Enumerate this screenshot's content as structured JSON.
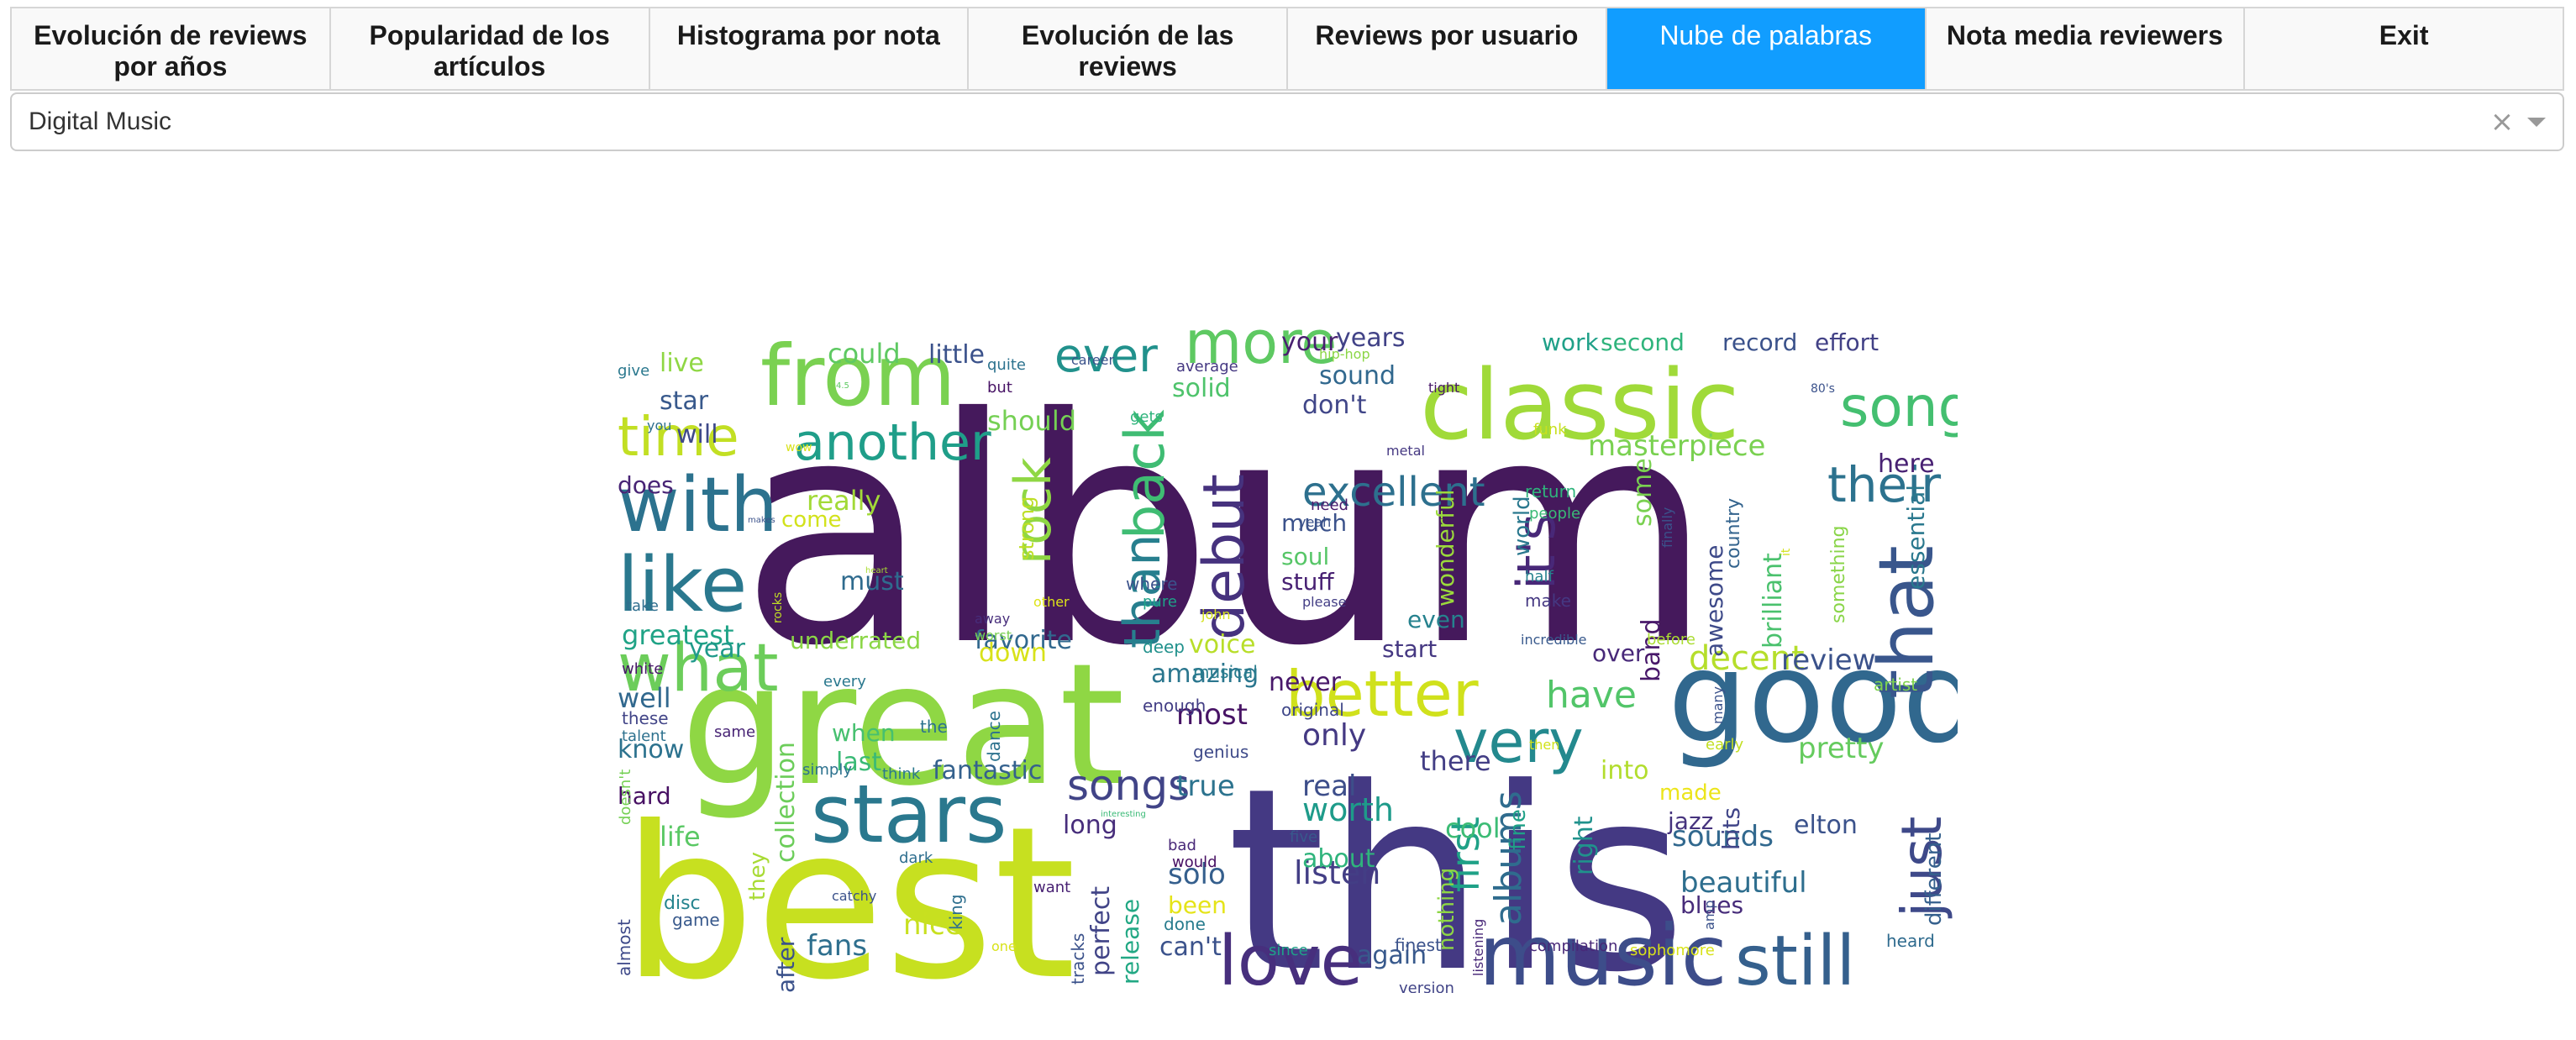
{
  "tabs": [
    {
      "label": "Evolución de reviews por años",
      "active": false
    },
    {
      "label": "Popularidad de los artículos",
      "active": false
    },
    {
      "label": "Histograma por nota",
      "active": false
    },
    {
      "label": "Evolución de las reviews",
      "active": false
    },
    {
      "label": "Reviews por usuario",
      "active": false
    },
    {
      "label": "Nube de palabras",
      "active": true
    },
    {
      "label": "Nota media reviewers",
      "active": false
    },
    {
      "label": "Exit",
      "active": false
    }
  ],
  "dropdown": {
    "selected": "Digital Music",
    "clear_icon": "×"
  },
  "colors": {
    "active_tab": "#119dff",
    "tab_bg": "#f9f9f9"
  },
  "wordcloud": {
    "words": [
      {
        "w": "album",
        "c": "#45195c"
      },
      {
        "w": "this",
        "c": "#443983"
      },
      {
        "w": "best",
        "c": "#c7e020"
      },
      {
        "w": "great",
        "c": "#8fd744"
      },
      {
        "w": "good",
        "c": "#31688e"
      },
      {
        "w": "classic",
        "c": "#a0da39"
      },
      {
        "w": "from",
        "c": "#7ad151"
      },
      {
        "w": "music",
        "c": "#3d4d8a"
      },
      {
        "w": "stars",
        "c": "#2a788e"
      },
      {
        "w": "love",
        "c": "#472f7d"
      },
      {
        "w": "still",
        "c": "#35608d"
      },
      {
        "w": "with",
        "c": "#2c728e"
      },
      {
        "w": "like",
        "c": "#2a788e"
      },
      {
        "w": "what",
        "c": "#6ccd5a"
      },
      {
        "w": "better",
        "c": "#d0e11c"
      },
      {
        "w": "very",
        "c": "#23898e"
      },
      {
        "w": "more",
        "c": "#5ec962"
      },
      {
        "w": "ever",
        "c": "#21918c"
      },
      {
        "w": "time",
        "c": "#c2df23"
      },
      {
        "w": "song",
        "c": "#44bf70"
      },
      {
        "w": "another",
        "c": "#1f9e89"
      },
      {
        "w": "their",
        "c": "#2c728e"
      },
      {
        "w": "that",
        "c": "#39568c"
      },
      {
        "w": "just",
        "c": "#3e4989"
      },
      {
        "w": "debut",
        "c": "#46327e"
      },
      {
        "w": "back",
        "c": "#3fbc73"
      },
      {
        "w": "rock",
        "c": "#8fd744"
      },
      {
        "w": "than",
        "c": "#277f8e"
      },
      {
        "w": "it's",
        "c": "#482878"
      },
      {
        "w": "excellent",
        "c": "#2d708e"
      },
      {
        "w": "have",
        "c": "#52c569"
      },
      {
        "w": "songs",
        "c": "#414487"
      },
      {
        "w": "albums",
        "c": "#2f6c8e"
      },
      {
        "w": "first",
        "c": "#1fa187"
      },
      {
        "w": "masterpiece",
        "c": "#7ad151"
      },
      {
        "w": "decent",
        "c": "#b5de2b"
      },
      {
        "w": "review",
        "c": "#3b528b"
      },
      {
        "w": "pretty",
        "c": "#65cb5e"
      },
      {
        "w": "sounds",
        "c": "#31688e"
      },
      {
        "w": "beautiful",
        "c": "#2e6e8e"
      },
      {
        "w": "listen",
        "c": "#433e85"
      },
      {
        "w": "fans",
        "c": "#2e6f8e"
      },
      {
        "w": "nice",
        "c": "#c8e020"
      },
      {
        "w": "solo",
        "c": "#355f8d"
      },
      {
        "w": "worth",
        "c": "#1e9b8a"
      },
      {
        "w": "real",
        "c": "#3d4e8a"
      },
      {
        "w": "true",
        "c": "#2c738e"
      },
      {
        "w": "only",
        "c": "#443983"
      },
      {
        "w": "never",
        "c": "#48186a"
      },
      {
        "w": "most",
        "c": "#471365"
      },
      {
        "w": "amazing",
        "c": "#2a768e"
      },
      {
        "w": "voice",
        "c": "#b8de29"
      },
      {
        "w": "favorite",
        "c": "#31688e"
      },
      {
        "w": "underrated",
        "c": "#8bd646"
      },
      {
        "w": "fantastic",
        "c": "#34618d"
      },
      {
        "w": "long",
        "c": "#472d7b"
      },
      {
        "w": "greatest",
        "c": "#20a386"
      },
      {
        "w": "must",
        "c": "#2f6b8e"
      },
      {
        "w": "really",
        "c": "#a2da37"
      },
      {
        "w": "should",
        "c": "#75d054"
      },
      {
        "w": "little",
        "c": "#3b528b"
      },
      {
        "w": "could",
        "c": "#5ec962"
      },
      {
        "w": "live",
        "c": "#8fd744"
      },
      {
        "w": "star",
        "c": "#38598c"
      },
      {
        "w": "will",
        "c": "#3e4989"
      },
      {
        "w": "does",
        "c": "#482475"
      },
      {
        "w": "well",
        "c": "#31688e"
      },
      {
        "w": "know",
        "c": "#2c728e"
      },
      {
        "w": "hard",
        "c": "#471063"
      },
      {
        "w": "life",
        "c": "#5ac864"
      },
      {
        "w": "year",
        "c": "#1f9a8a"
      },
      {
        "w": "down",
        "c": "#d8e219"
      },
      {
        "w": "collection",
        "c": "#6ccd5a"
      },
      {
        "w": "last",
        "c": "#3aba76"
      },
      {
        "w": "when",
        "c": "#46c06f"
      },
      {
        "w": "after",
        "c": "#3b528b"
      },
      {
        "w": "perfect",
        "c": "#414487"
      },
      {
        "w": "release",
        "c": "#22a884"
      },
      {
        "w": "been",
        "c": "#e5e419"
      },
      {
        "w": "can't",
        "c": "#3b528b"
      },
      {
        "w": "again",
        "c": "#38598c"
      },
      {
        "w": "about",
        "c": "#2fb47c"
      },
      {
        "w": "cool",
        "c": "#3cbc75"
      },
      {
        "w": "there",
        "c": "#433e85"
      },
      {
        "w": "even",
        "c": "#26828e"
      },
      {
        "w": "start",
        "c": "#453882"
      },
      {
        "w": "over",
        "c": "#482979"
      },
      {
        "w": "into",
        "c": "#b2dd2d"
      },
      {
        "w": "made",
        "c": "#ece51b"
      },
      {
        "w": "jazz",
        "c": "#46337e"
      },
      {
        "w": "hits",
        "c": "#404588"
      },
      {
        "w": "elton",
        "c": "#3b528b"
      },
      {
        "w": "blues",
        "c": "#472c7a"
      },
      {
        "w": "right",
        "c": "#20928c"
      },
      {
        "w": "band",
        "c": "#48186a"
      },
      {
        "w": "awesome",
        "c": "#3e4a89"
      },
      {
        "w": "brilliant",
        "c": "#4ac16d"
      },
      {
        "w": "essential",
        "c": "#2a788e"
      },
      {
        "w": "here",
        "c": "#482173"
      },
      {
        "w": "some",
        "c": "#7ad151"
      },
      {
        "w": "don't",
        "c": "#404688"
      },
      {
        "w": "sound",
        "c": "#31688e"
      },
      {
        "w": "solid",
        "c": "#4ec36b"
      },
      {
        "w": "your",
        "c": "#481f70"
      },
      {
        "w": "years",
        "c": "#414287"
      },
      {
        "w": "work",
        "c": "#1fa088"
      },
      {
        "w": "second",
        "c": "#2fb47c"
      },
      {
        "w": "record",
        "c": "#3b528b"
      },
      {
        "w": "effort",
        "c": "#424186"
      },
      {
        "w": "soul",
        "c": "#56c667"
      },
      {
        "w": "much",
        "c": "#3b528b"
      },
      {
        "w": "stuff",
        "c": "#482173"
      },
      {
        "w": "wonderful",
        "c": "#9bd93c"
      },
      {
        "w": "world",
        "c": "#2a788e"
      },
      {
        "w": "different",
        "c": "#35608d"
      },
      {
        "w": "come",
        "c": "#d2e21b"
      },
      {
        "w": "strong",
        "c": "#bddf26"
      },
      {
        "w": "nothing",
        "c": "#8ed645"
      },
      {
        "w": "they",
        "c": "#a8db34"
      },
      {
        "w": "fine",
        "c": "#1fa187"
      },
      {
        "w": "country",
        "c": "#33638d"
      },
      {
        "w": "something",
        "c": "#89d548"
      },
      {
        "w": "artist",
        "c": "#7fd34e"
      },
      {
        "w": "tracks",
        "c": "#3b528b"
      },
      {
        "w": "dance",
        "c": "#2c728e"
      },
      {
        "w": "musical",
        "c": "#287d8e"
      },
      {
        "w": "original",
        "c": "#3f4788"
      },
      {
        "w": "genius",
        "c": "#3e4a89"
      },
      {
        "w": "enough",
        "c": "#433e85"
      },
      {
        "w": "deep",
        "c": "#21918c"
      },
      {
        "w": "every",
        "c": "#2a788e"
      },
      {
        "w": "these",
        "c": "#414487"
      },
      {
        "w": "talent",
        "c": "#2d718e"
      },
      {
        "w": "white",
        "c": "#481769"
      },
      {
        "w": "take",
        "c": "#2e6e8e"
      },
      {
        "w": "game",
        "c": "#38598c"
      },
      {
        "w": "disc",
        "c": "#25848e"
      },
      {
        "w": "almost",
        "c": "#3e4989"
      },
      {
        "w": "doesn't",
        "c": "#75d054"
      },
      {
        "w": "same",
        "c": "#482475"
      },
      {
        "w": "simply",
        "c": "#2c728e"
      },
      {
        "w": "think",
        "c": "#2a788e"
      },
      {
        "w": "the",
        "c": "#2c728e"
      },
      {
        "w": "king",
        "c": "#2e6f8e"
      },
      {
        "w": "dark",
        "c": "#2e6e8e"
      },
      {
        "w": "catchy",
        "c": "#3b528b"
      },
      {
        "w": "want",
        "c": "#482173"
      },
      {
        "w": "bad",
        "c": "#482878"
      },
      {
        "w": "would",
        "c": "#471063"
      },
      {
        "w": "five",
        "c": "#38598c"
      },
      {
        "w": "done",
        "c": "#287c8e"
      },
      {
        "w": "since",
        "c": "#1fa188"
      },
      {
        "w": "finest",
        "c": "#3b528b"
      },
      {
        "w": "version",
        "c": "#414487"
      },
      {
        "w": "compilation",
        "c": "#482878"
      },
      {
        "w": "sophomore",
        "c": "#d8e219"
      },
      {
        "w": "heard",
        "c": "#2f6b8e"
      },
      {
        "w": "listening",
        "c": "#482878"
      },
      {
        "w": "amp",
        "c": "#3b528b"
      },
      {
        "w": "early",
        "c": "#c2df23"
      },
      {
        "w": "then",
        "c": "#d2e21b"
      },
      {
        "w": "before",
        "c": "#aadc32"
      },
      {
        "w": "incredible",
        "c": "#38598c"
      },
      {
        "w": "many",
        "c": "#3b528b"
      },
      {
        "w": "where",
        "c": "#3b528b"
      },
      {
        "w": "pure",
        "c": "#1fa188"
      },
      {
        "w": "john",
        "c": "#d5e21a"
      },
      {
        "w": "please",
        "c": "#433e85"
      },
      {
        "w": "other",
        "c": "#dde318"
      },
      {
        "w": "away",
        "c": "#472d7b"
      },
      {
        "w": "worst",
        "c": "#7ad151"
      },
      {
        "w": "need",
        "c": "#481b6d"
      },
      {
        "w": "yeah",
        "c": "#3b528b"
      },
      {
        "w": "make",
        "c": "#453882"
      },
      {
        "w": "half",
        "c": "#26828e"
      },
      {
        "w": "people",
        "c": "#3aba76"
      },
      {
        "w": "return",
        "c": "#2fb47c"
      },
      {
        "w": "finally",
        "c": "#3b528b"
      },
      {
        "w": "metal",
        "c": "#453882"
      },
      {
        "w": "funk",
        "c": "#c8e020"
      },
      {
        "w": "tight",
        "c": "#481769"
      },
      {
        "w": "80's",
        "c": "#3b528b"
      },
      {
        "w": "it",
        "c": "#d2e21b"
      },
      {
        "w": "hip-hop",
        "c": "#8bd646"
      },
      {
        "w": "average",
        "c": "#453882"
      },
      {
        "w": "career",
        "c": "#3b528b"
      },
      {
        "w": "quite",
        "c": "#2c728e"
      },
      {
        "w": "but",
        "c": "#471365"
      },
      {
        "w": "gets",
        "c": "#2fb47c"
      },
      {
        "w": "give",
        "c": "#2a788e"
      },
      {
        "w": "you",
        "c": "#2e6f8e"
      },
      {
        "w": "wow",
        "c": "#d8e219"
      },
      {
        "w": "4.5",
        "c": "#5ec962"
      },
      {
        "w": "makes",
        "c": "#3b528b"
      },
      {
        "w": "heart",
        "c": "#aadc32"
      },
      {
        "w": "rocks",
        "c": "#c2df23"
      },
      {
        "w": "interesting",
        "c": "#3aba76"
      },
      {
        "w": "one",
        "c": "#d8e219"
      }
    ]
  }
}
